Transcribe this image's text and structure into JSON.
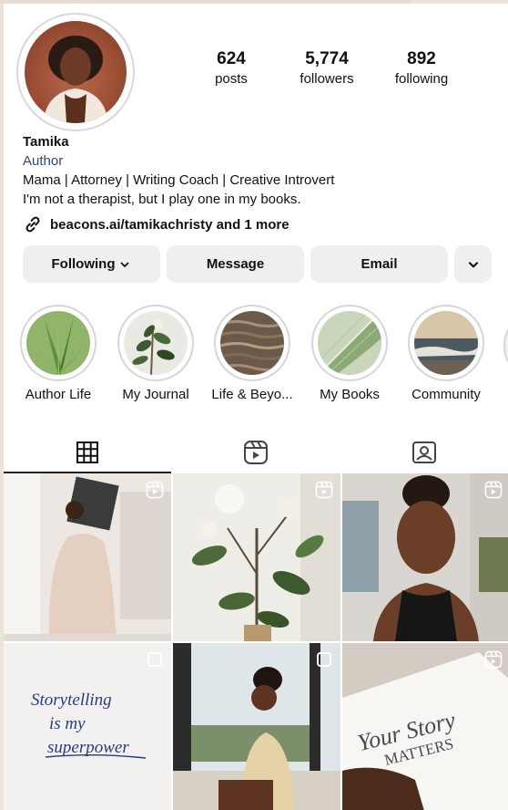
{
  "profile": {
    "name": "Tamika",
    "category": "Author",
    "bio_line1": "Mama | Attorney | Writing Coach | Creative Introvert",
    "bio_line2": "I'm not a therapist, but I play one in my books.",
    "link": "beacons.ai/tamikachristy and 1 more"
  },
  "stats": [
    {
      "value": "624",
      "label": "posts"
    },
    {
      "value": "5,774",
      "label": "followers"
    },
    {
      "value": "892",
      "label": "following"
    }
  ],
  "buttons": {
    "following": "Following",
    "message": "Message",
    "email": "Email"
  },
  "highlights": [
    {
      "label": "Author Life"
    },
    {
      "label": "My Journal"
    },
    {
      "label": "Life & Beyo..."
    },
    {
      "label": "My Books"
    },
    {
      "label": "Community"
    }
  ],
  "tabs": [
    {
      "icon": "grid-icon",
      "active": true
    },
    {
      "icon": "reels-icon",
      "active": false
    },
    {
      "icon": "tagged-icon",
      "active": false
    }
  ],
  "posts": [
    {
      "type": "reel",
      "caption": ""
    },
    {
      "type": "reel",
      "caption": ""
    },
    {
      "type": "reel",
      "caption": ""
    },
    {
      "type": "carousel",
      "caption": "Storytelling is my superpower"
    },
    {
      "type": "carousel",
      "caption": ""
    },
    {
      "type": "reel",
      "caption": "Your Story MATTERS"
    }
  ],
  "colors": {
    "link_blue": "#2c4a80",
    "button_bg": "#efefef"
  }
}
